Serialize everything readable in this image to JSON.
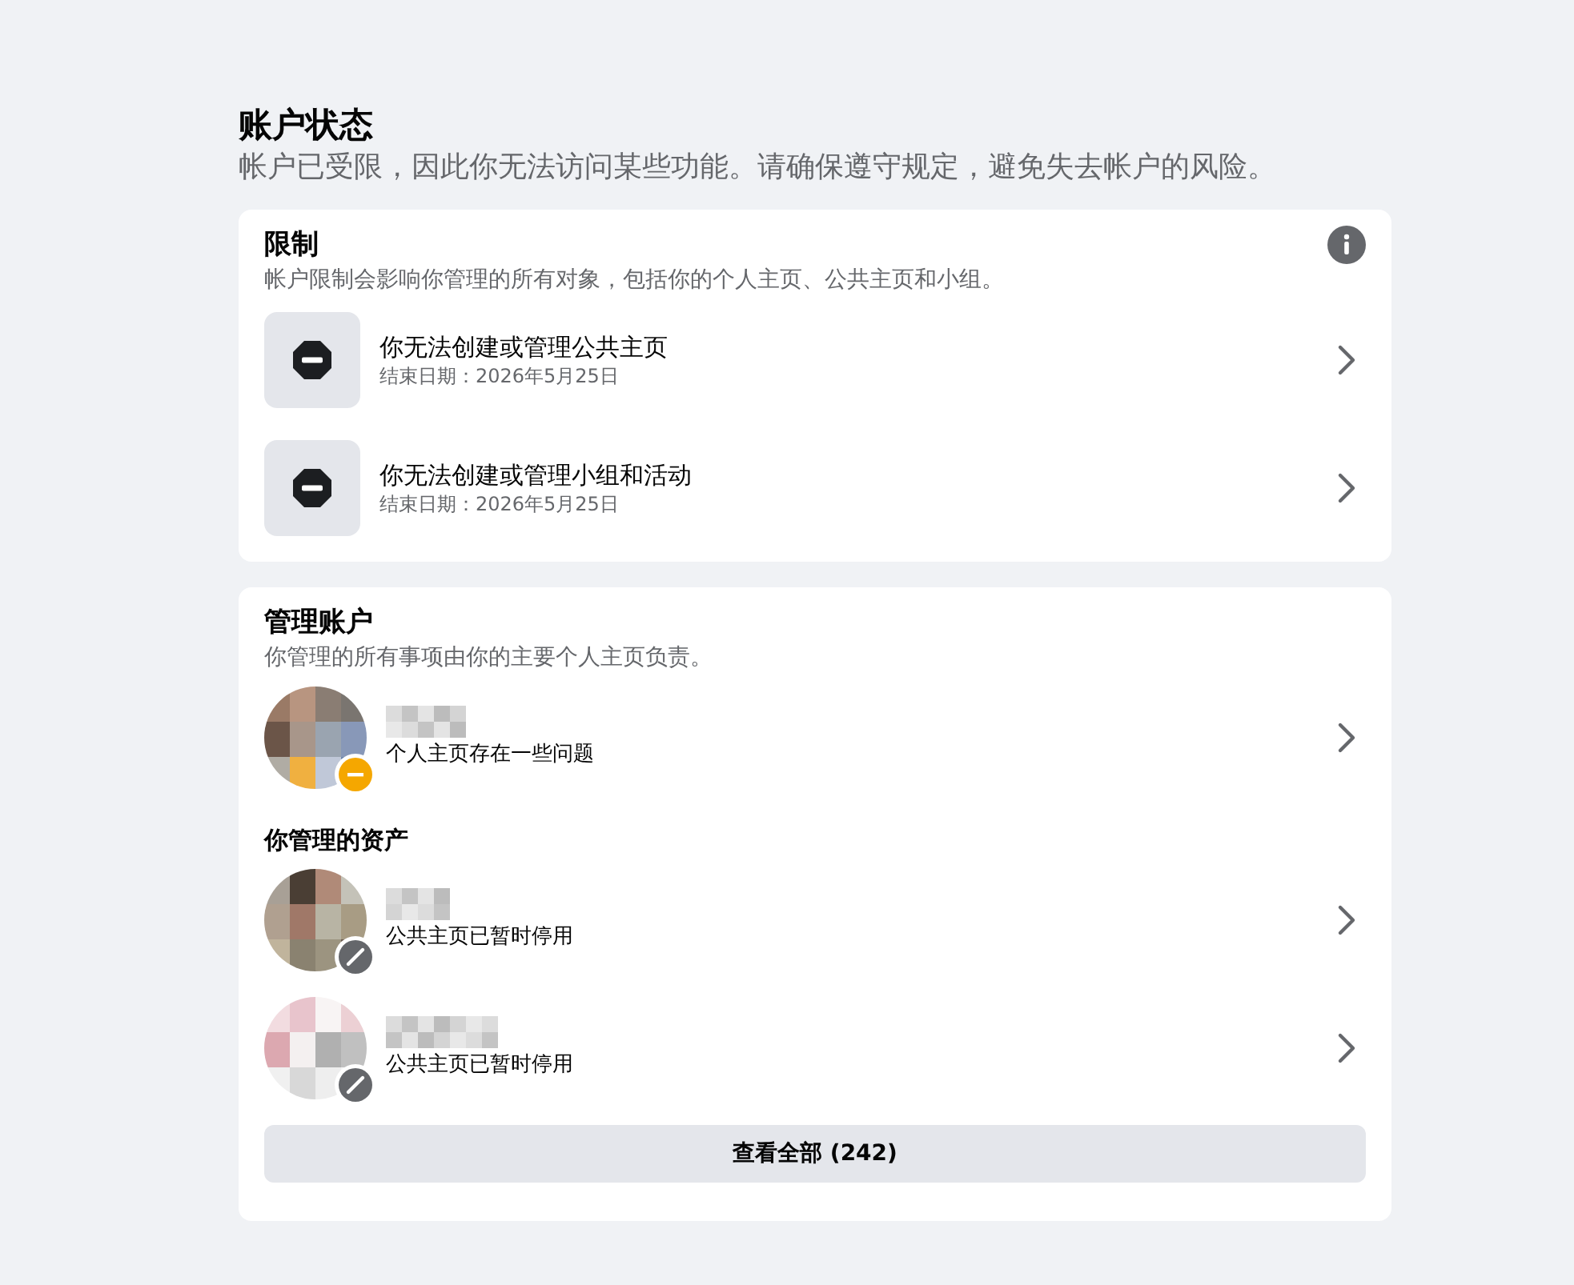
{
  "header": {
    "title": "账户状态",
    "subtitle": "帐户已受限，因此你无法访问某些功能。请确保遵守规定，避免失去帐户的风险。"
  },
  "restrictions": {
    "title": "限制",
    "description": "帐户限制会影响你管理的所有对象，包括你的个人主页、公共主页和小组。",
    "items": [
      {
        "title": "你无法创建或管理公共主页",
        "detail": "结束日期：2026年5月25日"
      },
      {
        "title": "你无法创建或管理小组和活动",
        "detail": "结束日期：2026年5月25日"
      }
    ]
  },
  "accounts": {
    "title": "管理账户",
    "description": "你管理的所有事项由你的主要个人主页负责。",
    "profile": {
      "status": "个人主页存在一些问题",
      "kind": "warning"
    },
    "assets_heading": "你管理的资产",
    "assets": [
      {
        "status": "公共主页已暂时停用",
        "kind": "disabled"
      },
      {
        "status": "公共主页已暂时停用",
        "kind": "disabled"
      }
    ],
    "view_all": "查看全部 (242)"
  }
}
